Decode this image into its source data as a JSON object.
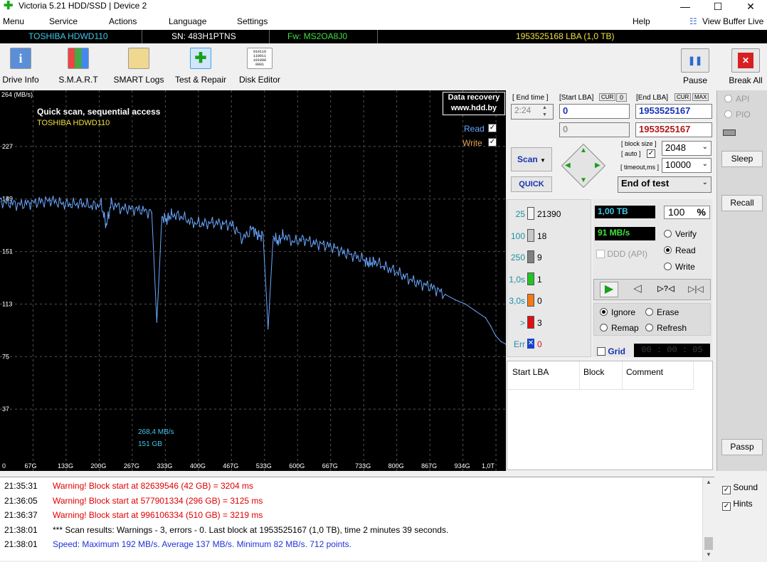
{
  "window": {
    "title": "Victoria 5.21 HDD/SSD | Device 2",
    "minimize": "—",
    "maximize": "☐",
    "close": "✕"
  },
  "menu": {
    "items": [
      "Menu",
      "Service",
      "Actions",
      "Language",
      "Settings"
    ],
    "help": "Help",
    "view_buffer": "View Buffer Live"
  },
  "drive": {
    "model": "TOSHIBA HDWD110",
    "serial": "SN: 483H1PTNS",
    "firmware": "Fw: MS2OA8J0",
    "capacity": "1953525168 LBA (1,0 TB)"
  },
  "toolbar": {
    "drive_info": "Drive Info",
    "smart": "S.M.A.R.T",
    "smart_logs": "SMART Logs",
    "test_repair": "Test & Repair",
    "disk_editor": "Disk Editor",
    "disk_editor_glyph": "010110\n110011\n101000\n0001",
    "pause": "Pause",
    "break_all": "Break All"
  },
  "graph": {
    "unit": "264 (MB/s)",
    "title": "Quick scan, sequential access",
    "subtitle": "TOSHIBA HDWD110",
    "read_label": "Read",
    "write_label": "Write",
    "badge_line1": "Data recovery",
    "badge_line2": "www.hdd.by",
    "y_ticks": [
      "227",
      "189",
      "151",
      "113",
      "75",
      "37"
    ],
    "x_ticks": [
      "0",
      "67G",
      "133G",
      "200G",
      "267G",
      "333G",
      "400G",
      "467G",
      "533G",
      "600G",
      "667G",
      "733G",
      "800G",
      "867G",
      "934G",
      "1,0T"
    ],
    "cursor_speed": "268,4 MB/s",
    "cursor_pos": "151 GB",
    "colors": {
      "read": "#6aa8ff",
      "grid": "#555555"
    }
  },
  "chart_data": {
    "type": "line",
    "xlim_gb": [
      0,
      1000
    ],
    "ylim_mbs": [
      0,
      264
    ],
    "series": [
      {
        "name": "Read",
        "x": [
          0,
          20,
          40,
          60,
          80,
          100,
          120,
          140,
          160,
          180,
          200,
          210,
          220,
          240,
          260,
          280,
          300,
          310,
          320,
          330,
          340,
          360,
          380,
          400,
          420,
          440,
          460,
          480,
          500,
          510,
          520,
          530,
          540,
          550,
          560,
          580,
          600,
          620,
          640,
          660,
          680,
          700,
          720,
          730,
          740,
          760,
          780,
          800,
          820,
          840,
          860,
          880,
          900,
          920,
          940,
          960,
          970,
          980,
          990,
          1000
        ],
        "y": [
          187,
          186,
          185,
          186,
          187,
          188,
          186,
          185,
          186,
          184,
          185,
          170,
          186,
          182,
          182,
          181,
          179,
          100,
          176,
          174,
          178,
          176,
          172,
          171,
          172,
          171,
          170,
          160,
          168,
          162,
          163,
          95,
          162,
          158,
          163,
          158,
          160,
          157,
          156,
          154,
          150,
          148,
          145,
          142,
          144,
          140,
          137,
          133,
          129,
          127,
          124,
          120,
          116,
          113,
          108,
          103,
          97,
          90,
          86,
          84
        ]
      }
    ]
  },
  "params": {
    "end_time_label": "[ End time ]",
    "end_time": "2:24",
    "start_lba_label": "[Start LBA]",
    "cur": "CUR",
    "zero": "0",
    "end_lba_label": "[End LBA]",
    "max": "MAX",
    "start_lba": "0",
    "end_lba": "1953525167",
    "start_lba2": "0",
    "end_lba2": "1953525167",
    "block_size_label": "[ block size ]",
    "auto_label": "[ auto ]",
    "timeout_label": "[ timeout,ms ]",
    "block_size": "2048",
    "timeout": "10000",
    "scan_label": "Scan",
    "quick_label": "QUICK",
    "end_of_test": "End of test"
  },
  "stats": {
    "rows": [
      {
        "label": "25",
        "count": "21390",
        "color": "#f4f4f4"
      },
      {
        "label": "100",
        "count": "18",
        "color": "#c8c8c8"
      },
      {
        "label": "250",
        "count": "9",
        "color": "#808080"
      },
      {
        "label": "1,0s",
        "count": "1",
        "color": "#22c422"
      },
      {
        "label": "3,0s",
        "count": "0",
        "color": "#f07a18"
      },
      {
        "label": ">",
        "count": "3",
        "color": "#e01010"
      },
      {
        "label": "Err",
        "count": "0",
        "color": "#1844c8"
      }
    ],
    "err_mark": "✕"
  },
  "status": {
    "size": "1,00 TB",
    "percent": "100",
    "percent_sign": "%",
    "speed": "91 MB/s",
    "ddd": "DDD (API)",
    "verify": "Verify",
    "read": "Read",
    "write": "Write",
    "ignore": "Ignore",
    "erase": "Erase",
    "remap": "Remap",
    "refresh": "Refresh",
    "grid": "Grid",
    "timer": "00 : 00 : 05"
  },
  "table": {
    "headers": [
      "Start LBA",
      "Block",
      "Comment"
    ]
  },
  "sidebar": {
    "api": "API",
    "pio": "PIO",
    "sleep": "Sleep",
    "recall": "Recall",
    "passp": "Passp",
    "sound": "Sound",
    "hints": "Hints"
  },
  "log": [
    {
      "time": "21:35:31",
      "text": "Warning! Block start at 82639546 (42 GB)  = 3204 ms",
      "color": "#e00000"
    },
    {
      "time": "21:36:05",
      "text": "Warning! Block start at 577901334 (296 GB)  = 3125 ms",
      "color": "#e00000"
    },
    {
      "time": "21:36:37",
      "text": "Warning! Block start at 996106334 (510 GB)  = 3219 ms",
      "color": "#e00000"
    },
    {
      "time": "21:38:01",
      "text": "*** Scan results: Warnings - 3, errors - 0. Last block at 1953525167 (1,0 TB), time 2 minutes 39 seconds.",
      "color": "#000000"
    },
    {
      "time": "21:38:01",
      "text": "Speed: Maximum 192 MB/s. Average 137 MB/s. Minimum 82 MB/s. 712 points.",
      "color": "#1d33d8"
    }
  ]
}
